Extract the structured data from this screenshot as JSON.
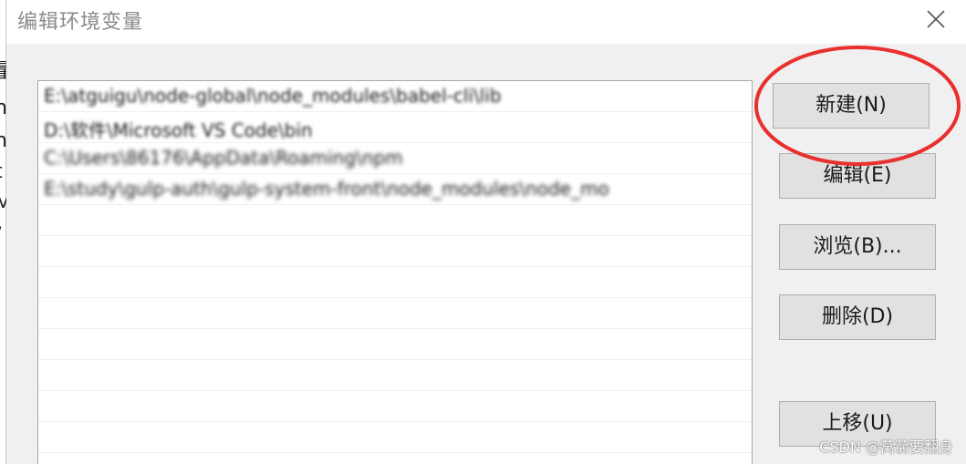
{
  "window": {
    "title": "编辑环境变量"
  },
  "background_window": {
    "glyphs": [
      "量",
      "n",
      "n",
      "t",
      "M",
      "/"
    ]
  },
  "path_list": {
    "entries": [
      "E:\\atguigu\\node-global\\node_modules\\babel-cli\\lib",
      "D:\\软件\\Microsoft VS Code\\bin",
      "C:\\Users\\86176\\AppData\\Roaming\\npm",
      "E:\\study\\gulp-auth\\gulp-system-front\\node_modules\\node_mo"
    ]
  },
  "buttons": {
    "new": "新建(N)",
    "edit": "编辑(E)",
    "browse": "浏览(B)...",
    "delete": "删除(D)",
    "move_up": "上移(U)"
  },
  "watermark": "CSDN @莴蒻要翻身",
  "colors": {
    "annotation": "#e8302e",
    "button_bg": "#e1e1e1",
    "dialog_bg": "#f0f0f0"
  }
}
